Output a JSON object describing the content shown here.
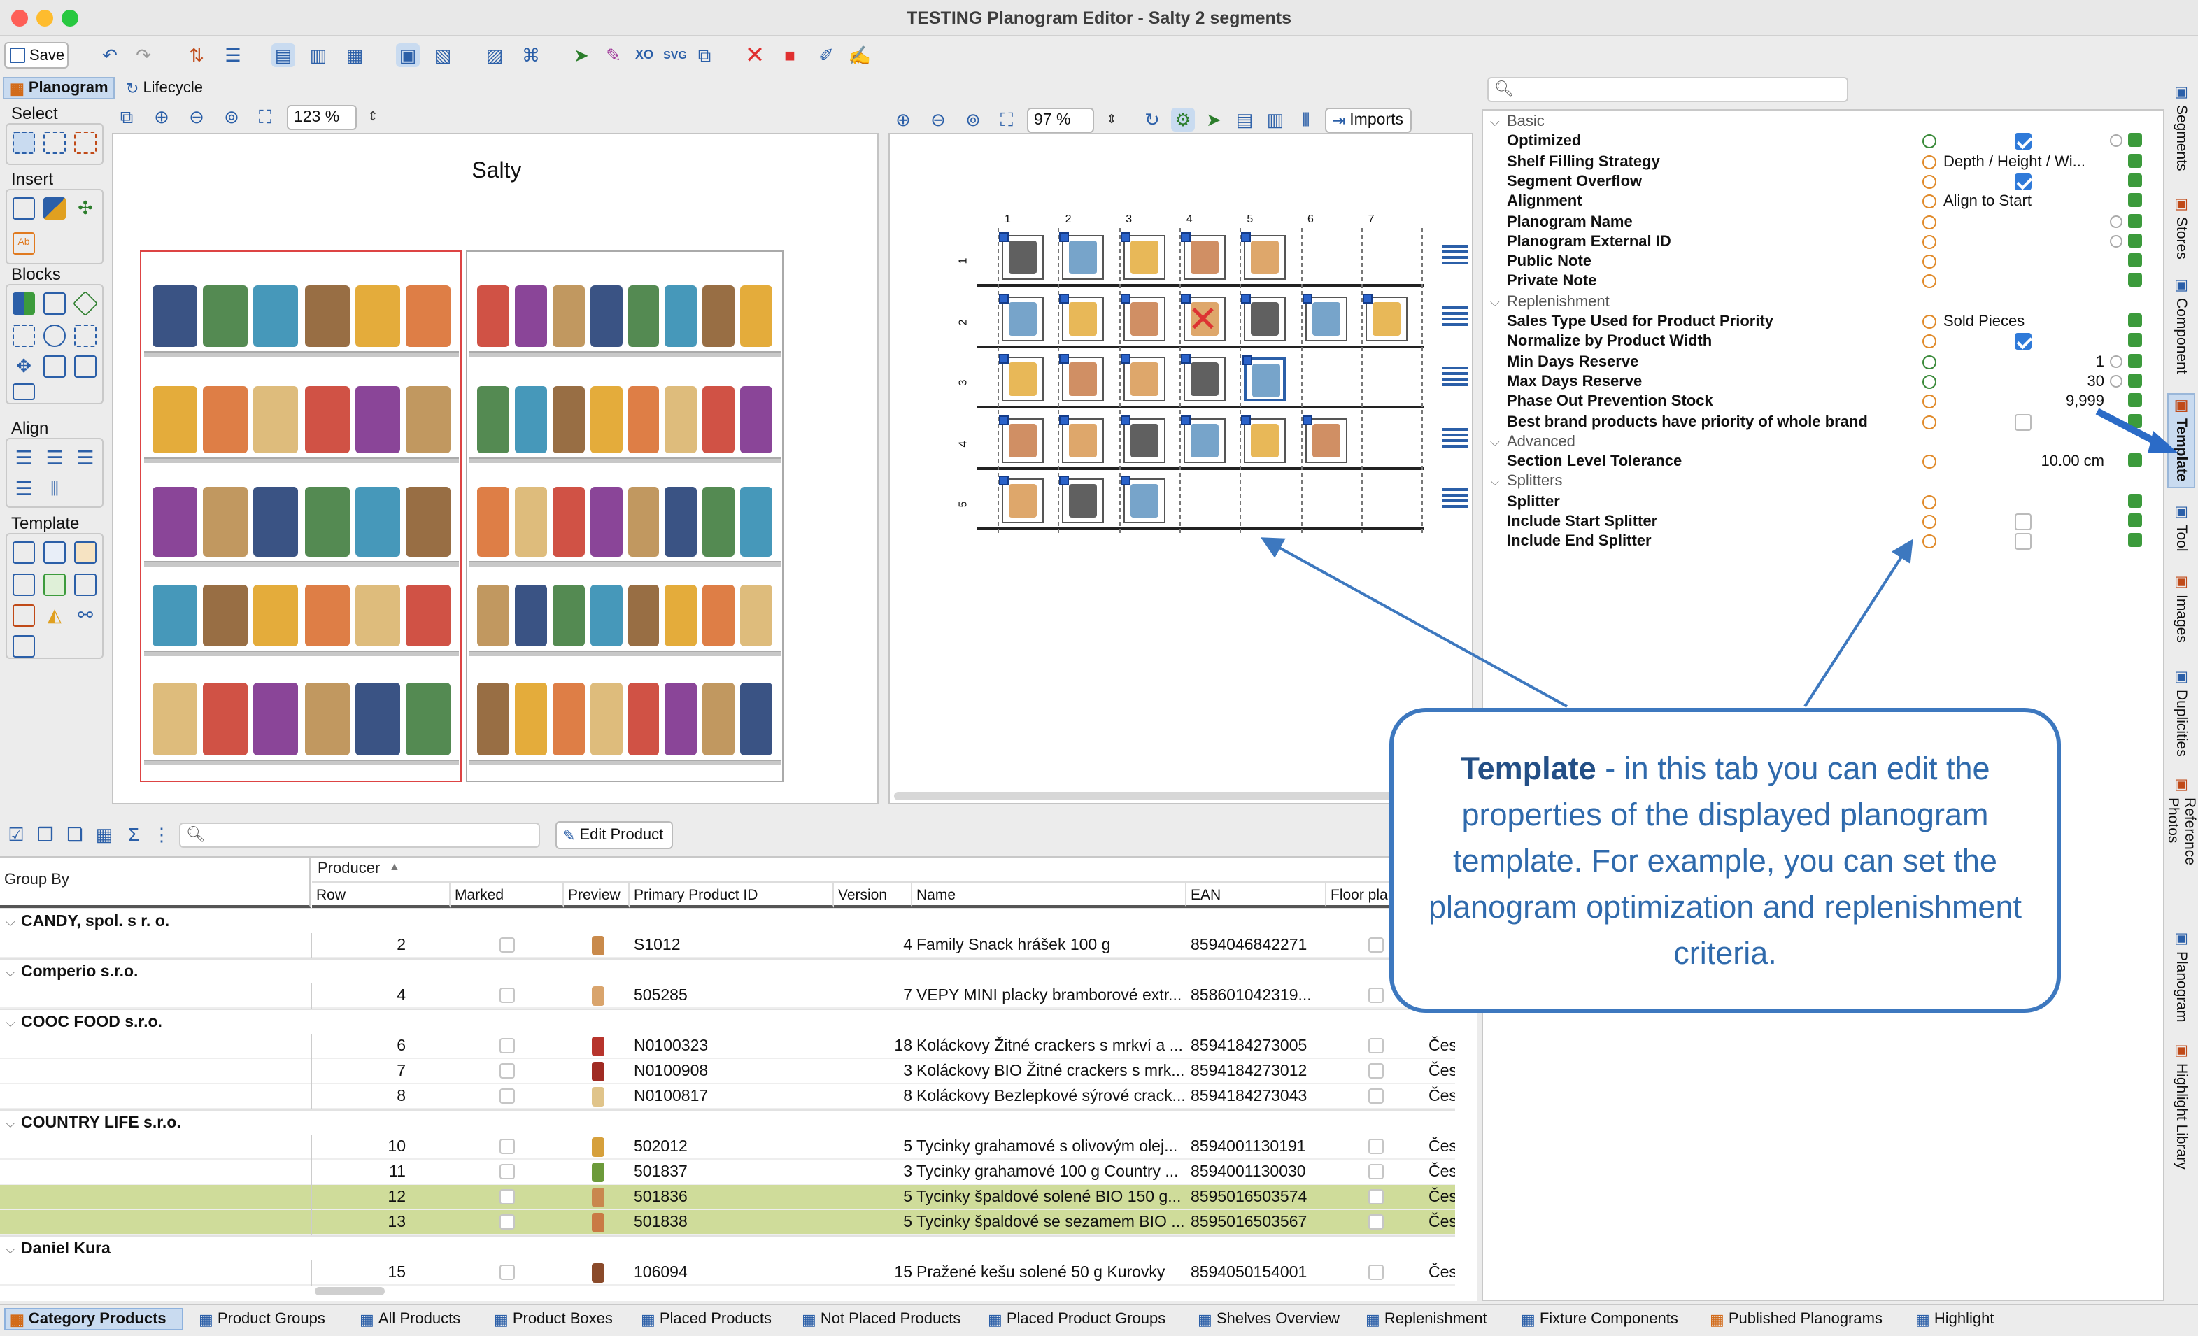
{
  "window": {
    "title": "TESTING Planogram Editor - Salty 2 segments"
  },
  "toolbar": {
    "save_label": "Save"
  },
  "tabs": {
    "planogram": "Planogram",
    "lifecycle": "Lifecycle"
  },
  "leftgroups": {
    "select": "Select",
    "insert": "Insert",
    "blocks": "Blocks",
    "align": "Align",
    "template": "Template"
  },
  "left_canvas": {
    "zoom": "123 %",
    "title": "Salty"
  },
  "right_canvas": {
    "zoom": "97 %",
    "imports_label": "Imports",
    "cols": [
      "1",
      "2",
      "3",
      "4",
      "5",
      "6",
      "7"
    ],
    "rows": [
      "1",
      "2",
      "3",
      "4",
      "5"
    ]
  },
  "props": {
    "search_placeholder": "",
    "rows": [
      {
        "t": "sec",
        "label": "Basic"
      },
      {
        "t": "row",
        "label": "Optimized",
        "cb": true
      },
      {
        "t": "row",
        "label": "Shelf Filling Strategy",
        "value": "Depth / Height / Wi..."
      },
      {
        "t": "row",
        "label": "Segment Overflow",
        "cb": true
      },
      {
        "t": "row",
        "label": "Alignment",
        "value": "Align to Start"
      },
      {
        "t": "row",
        "label": "Planogram Name",
        "value": ""
      },
      {
        "t": "row",
        "label": "Planogram External ID",
        "value": ""
      },
      {
        "t": "row",
        "label": "Public Note",
        "value": ""
      },
      {
        "t": "row",
        "label": "Private Note",
        "value": ""
      },
      {
        "t": "sec",
        "label": "Replenishment"
      },
      {
        "t": "row",
        "label": "Sales Type Used for Product Priority",
        "value": "Sold Pieces"
      },
      {
        "t": "row",
        "label": "Normalize by Product Width",
        "cb": true
      },
      {
        "t": "row",
        "label": "Min Days Reserve",
        "num": "1"
      },
      {
        "t": "row",
        "label": "Max Days Reserve",
        "num": "30"
      },
      {
        "t": "row",
        "label": "Phase Out Prevention Stock",
        "num": "9,999"
      },
      {
        "t": "row",
        "label": "Best brand products have priority of whole brand",
        "cb": false
      },
      {
        "t": "sec",
        "label": "Advanced"
      },
      {
        "t": "row",
        "label": "Section Level Tolerance",
        "num": "10.00 cm"
      },
      {
        "t": "sec",
        "label": "Splitters"
      },
      {
        "t": "row",
        "label": "Splitter",
        "value": ""
      },
      {
        "t": "row",
        "label": "Include Start Splitter",
        "cb": false
      },
      {
        "t": "row",
        "label": "Include End Splitter",
        "cb": false
      }
    ]
  },
  "vtabs": [
    "Segments",
    "Stores",
    "Component",
    "Template",
    "Tool",
    "Images",
    "Duplicities",
    "Reference Photos",
    "Planogram",
    "Highlight Library"
  ],
  "table": {
    "edit_product": "Edit Product",
    "search_placeholder": "",
    "group_by": "Group By",
    "producer": "Producer",
    "columns": [
      "Row",
      "Marked",
      "Preview",
      "Primary Product ID",
      "Version",
      "Name",
      "EAN",
      "Floor pla"
    ],
    "rows": [
      {
        "g": "CANDY, spol. s r. o."
      },
      {
        "r": "2",
        "id": "S1012",
        "v": "4",
        "name": "Family Snack hrášek 100 g",
        "ean": "8594046842271",
        "c": "",
        "pc": "#c98a4b"
      },
      {
        "g": "Comperio s.r.o."
      },
      {
        "r": "4",
        "id": "505285",
        "v": "7",
        "name": "VEPY MINI placky bramborové extr...",
        "ean": "858601042319...",
        "c": "",
        "pc": "#d9a46c"
      },
      {
        "g": "COOC FOOD s.r.o."
      },
      {
        "r": "6",
        "id": "N0100323",
        "v": "18",
        "name": "Koláckovy Žitné crackers s mrkví a ...",
        "ean": "8594184273005",
        "c": "Čes",
        "pc": "#b7342c"
      },
      {
        "r": "7",
        "id": "N0100908",
        "v": "3",
        "name": "Koláckovy BIO Žitné crackers s mrk...",
        "ean": "8594184273012",
        "c": "Čes",
        "pc": "#a02b23"
      },
      {
        "r": "8",
        "id": "N0100817",
        "v": "8",
        "name": "Koláckovy Bezlepkové sýrové crack...",
        "ean": "8594184273043",
        "c": "Čes",
        "pc": "#e0c48a"
      },
      {
        "g": "COUNTRY LIFE s.r.o."
      },
      {
        "r": "10",
        "id": "502012",
        "v": "5",
        "name": "Tycinky grahamové s olivovým olej...",
        "ean": "8594001130191",
        "c": "Čes",
        "pc": "#d6a03c"
      },
      {
        "r": "11",
        "id": "501837",
        "v": "3",
        "name": "Tycinky grahamové 100 g Country ...",
        "ean": "8594001130030",
        "c": "Čes",
        "pc": "#6c9a3a"
      },
      {
        "r": "12",
        "id": "501836",
        "v": "5",
        "name": "Tycinky špaldové solené BIO 150 g...",
        "ean": "8595016503574",
        "c": "Čes",
        "pc": "#c9874e",
        "hl": true
      },
      {
        "r": "13",
        "id": "501838",
        "v": "5",
        "name": "Tycinky špaldové se sezamem BIO ...",
        "ean": "8595016503567",
        "c": "Čes",
        "pc": "#c97a44",
        "hl": true
      },
      {
        "g": "Daniel Kura"
      },
      {
        "r": "15",
        "id": "106094",
        "v": "15",
        "name": "Pražené kešu solené 50 g Kurovky",
        "ean": "8594050154001",
        "c": "Čes",
        "pc": "#8a4a2a"
      }
    ]
  },
  "bottom_tabs": [
    "Category Products",
    "Product Groups",
    "All Products",
    "Product Boxes",
    "Placed Products",
    "Not Placed Products",
    "Placed Product Groups",
    "Shelves Overview",
    "Replenishment",
    "Fixture Components",
    "Published Planograms",
    "Highlight"
  ],
  "callout": {
    "bold": "Template",
    "text": " - in this tab you can edit the properties of the displayed planogram template. For example, you can set the planogram optimization and replenishment criteria."
  },
  "colors": {
    "accent": "#2f7ad9",
    "callout": "#3d78bf",
    "highlight_row": "#cfdc9a"
  }
}
